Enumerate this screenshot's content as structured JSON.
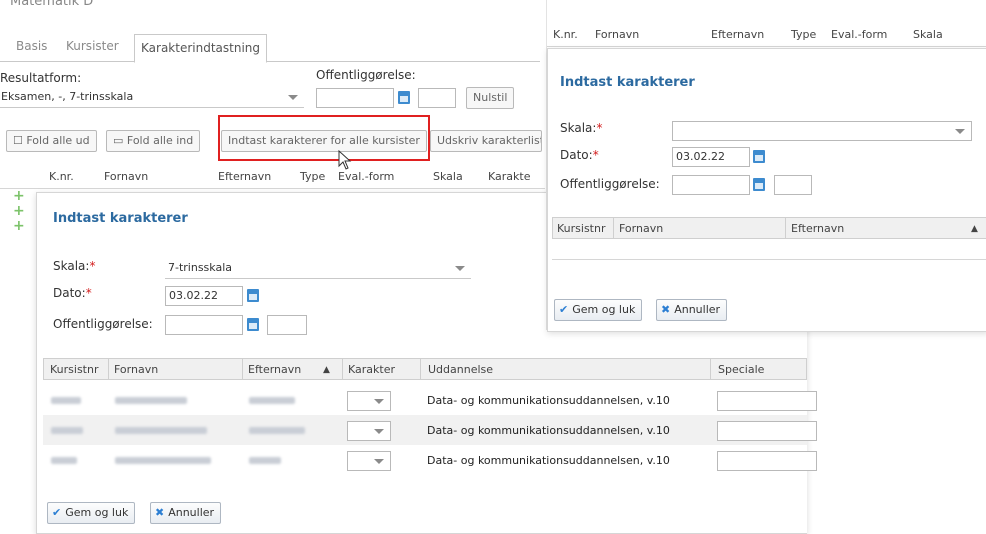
{
  "header": {
    "title": "Matematik D"
  },
  "tabs": [
    {
      "label": "Basis"
    },
    {
      "label": "Kursister"
    },
    {
      "label": "Karakterindtastning"
    }
  ],
  "filters": {
    "resultatform_label": "Resultatform:",
    "resultatform_value": "Eksamen, -, 7-trinsskala",
    "offentlig_label": "Offentliggørelse:",
    "nulstil_label": "Nulstil"
  },
  "toolbar": {
    "fold_out": "Fold alle ud",
    "fold_in": "Fold alle ind",
    "enter_all": "Indtast karakterer for alle kursister",
    "print": "Udskriv karakterliste"
  },
  "bg_columns": [
    "K.nr.",
    "Fornavn",
    "Efternavn",
    "Type",
    "Eval.-form",
    "Skala",
    "Karakte"
  ],
  "dialog_main": {
    "title": "Indtast karakterer",
    "skala_label": "Skala:",
    "skala_value": "7-trinsskala",
    "dato_label": "Dato:",
    "dato_value": "03.02.22",
    "offentlig_label": "Offentliggørelse:",
    "columns": [
      "Kursistnr",
      "Fornavn",
      "Efternavn",
      "Karakter",
      "Uddannelse",
      "Speciale"
    ],
    "rows": [
      {
        "uddannelse": "Data- og kommunikationsuddannelsen, v.10"
      },
      {
        "uddannelse": "Data- og kommunikationsuddannelsen, v.10"
      },
      {
        "uddannelse": "Data- og kommunikationsuddannelsen, v.10"
      }
    ],
    "save_label": "Gem og luk",
    "cancel_label": "Annuller"
  },
  "dialog_right": {
    "bg_columns": [
      "K.nr.",
      "Fornavn",
      "Efternavn",
      "Type",
      "Eval.-form",
      "Skala"
    ],
    "title": "Indtast karakterer",
    "skala_label": "Skala:",
    "dato_label": "Dato:",
    "dato_value": "03.02.22",
    "offentlig_label": "Offentliggørelse:",
    "columns": [
      "Kursistnr",
      "Fornavn",
      "Efternavn"
    ],
    "save_label": "Gem og luk",
    "cancel_label": "Annuller"
  },
  "colors": {
    "accent": "#2c6aa0",
    "highlight": "#e02020",
    "required": "#d21a1a"
  }
}
